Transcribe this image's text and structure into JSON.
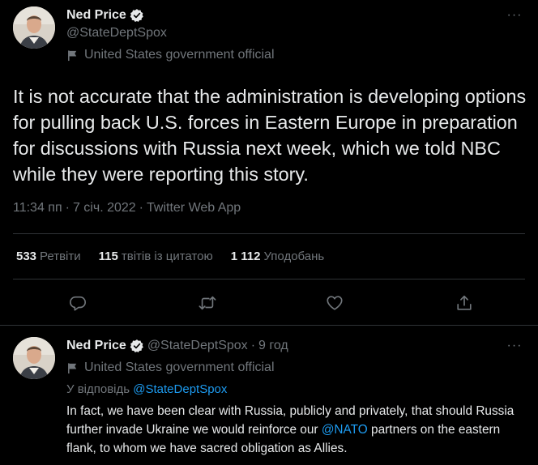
{
  "colors": {
    "background": "#000000",
    "text": "#e7e9ea",
    "muted": "#71767b",
    "link": "#1d9bf0",
    "verified": "#e7e9ea",
    "border": "#2f3336"
  },
  "main_tweet": {
    "author_name": "Ned Price",
    "author_handle": "@StateDeptSpox",
    "government_label": "United States government official",
    "text": "It is not accurate that the administration is developing options for pulling back U.S. forces in Eastern Europe in preparation for discussions with Russia next week, which we told NBC while they were reporting this story.",
    "time": "11:34 пп",
    "dot": "·",
    "date": "7 січ. 2022",
    "source": "Twitter Web App",
    "stats": {
      "retweets_count": "533",
      "retweets_label": "Ретвіти",
      "quotes_count": "115",
      "quotes_label": "твітів із цитатою",
      "likes_count": "1 112",
      "likes_label": "Уподобань"
    },
    "actions": {
      "reply_icon": "reply-icon",
      "retweet_icon": "retweet-icon",
      "like_icon": "heart-icon",
      "share_icon": "share-icon"
    },
    "more_glyph": "···"
  },
  "reply_tweet": {
    "author_name": "Ned Price",
    "author_handle": "@StateDeptSpox",
    "separator": "·",
    "time_ago": "9 год",
    "government_label": "United States government official",
    "replying_prefix": "У відповідь",
    "replying_to": "@StateDeptSpox",
    "text_part1": "In fact, we have been clear with Russia, publicly and privately, that should Russia further invade Ukraine we would reinforce our ",
    "mention": "@NATO",
    "text_part2": " partners on the eastern flank, to whom we have sacred obligation as Allies.",
    "more_glyph": "···"
  }
}
